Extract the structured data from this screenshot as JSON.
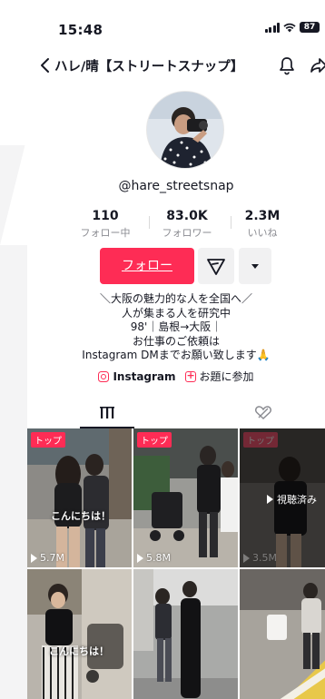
{
  "status_bar": {
    "time": "15:48",
    "battery": "87"
  },
  "header": {
    "title": "ハレ/晴【ストリートスナップ】"
  },
  "profile": {
    "username": "@hare_streetsnap"
  },
  "stats": [
    {
      "value": "110",
      "label": "フォロー中"
    },
    {
      "value": "83.0K",
      "label": "フォロワー"
    },
    {
      "value": "2.3M",
      "label": "いいね"
    }
  ],
  "actions": {
    "follow_label": "フォロー"
  },
  "bio": {
    "lines": [
      "＼大阪の魅力的な人を全国へ／",
      "人が集まる人を研究中",
      "98'｜島根→大阪｜",
      "お仕事のご依頼は",
      "Instagram DMまでお願い致します🙏"
    ]
  },
  "links": {
    "instagram": "Instagram",
    "topic": "お題に参加"
  },
  "videos": [
    {
      "badge": "トップ",
      "views": "5.7M",
      "caption": "こんにちは！"
    },
    {
      "badge": "トップ",
      "views": "5.8M",
      "caption": ""
    },
    {
      "badge": "トップ",
      "views": "3.5M",
      "watched_label": "視聴済み"
    },
    {
      "badge": "",
      "views": "",
      "caption": "こんにちは！"
    },
    {
      "badge": "",
      "views": "",
      "caption": ""
    },
    {
      "badge": "",
      "views": "",
      "caption": ""
    }
  ],
  "colors": {
    "accent": "#fe2c55",
    "text": "#161823",
    "muted": "#8a8b91"
  },
  "icons": [
    "back-arrow-icon",
    "bell-icon",
    "share-icon",
    "paper-plane-icon",
    "caret-down-icon",
    "grid-icon",
    "liked-heart-icon",
    "instagram-icon",
    "topic-icon"
  ]
}
